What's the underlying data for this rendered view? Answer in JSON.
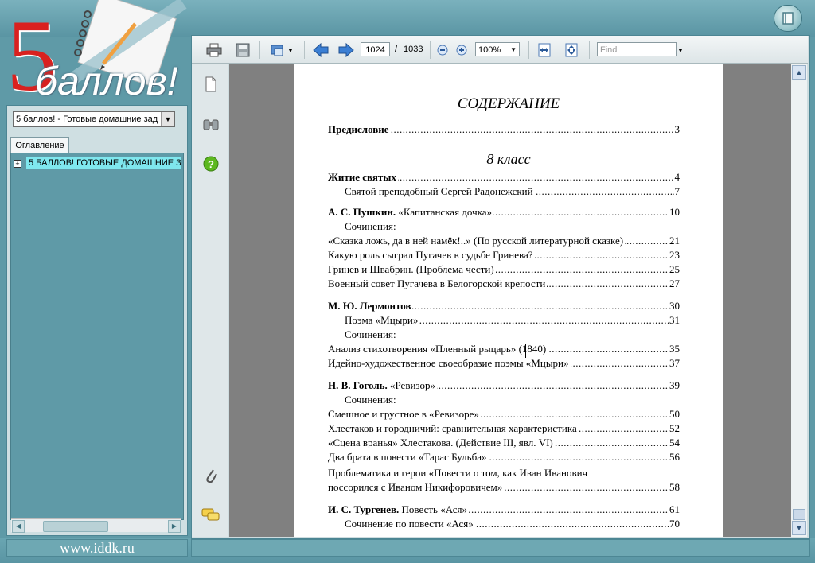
{
  "logo": {
    "number": "5",
    "word": "баллов!"
  },
  "left_panel": {
    "document_select": "5 баллов! - Готовые домашние зад",
    "tab_label": "Оглавление",
    "tree_item": "5 БАЛЛОВ! ГОТОВЫЕ ДОМАШНИЕ З",
    "tree_expand": "+"
  },
  "footer": {
    "site": "www.iddk.ru"
  },
  "toolbar": {
    "page_current": "1024",
    "page_separator": "/",
    "page_total": "1033",
    "zoom": "100%",
    "find_placeholder": "Find"
  },
  "document": {
    "title": "СОДЕРЖАНИЕ",
    "section": "8 класс",
    "rows": [
      {
        "text": "Предисловие",
        "bold_prefix": "Предисловие",
        "page": "3",
        "indent": false
      },
      {
        "text": "Житие святых",
        "bold_prefix": "Житие святых",
        "page": "4",
        "indent": false
      },
      {
        "text": "Святой преподобный Сергей Радонежский ",
        "bold_prefix": "",
        "page": " 7",
        "indent": true
      },
      {
        "text": " «Капитанская дочка» ",
        "bold_prefix": "А. С. Пушкин.",
        "page": "10",
        "indent": false
      },
      {
        "text": "Сочинения:",
        "bold_prefix": "",
        "page": "",
        "indent": true
      },
      {
        "text": "«Сказка ложь, да в ней намёк!..» (По русской литературной сказке)",
        "bold_prefix": "",
        "page": "21",
        "indent": false
      },
      {
        "text": "Какую роль сыграл Пугачев в судьбе Гринева?",
        "bold_prefix": "",
        "page": "23",
        "indent": false
      },
      {
        "text": "Гринев и Швабрин. (Проблема чести)",
        "bold_prefix": "",
        "page": "25",
        "indent": false
      },
      {
        "text": "Военный совет Пугачева в Белогорской крепости",
        "bold_prefix": "",
        "page": "27",
        "indent": false
      },
      {
        "text": " ",
        "bold_prefix": "М. Ю. Лермонтов",
        "page": "30",
        "indent": false
      },
      {
        "text": "Поэма «Мцыри» ",
        "bold_prefix": "",
        "page": "31",
        "indent": true
      },
      {
        "text": "Сочинения:",
        "bold_prefix": "",
        "page": "",
        "indent": true
      },
      {
        "text": "Анализ стихотворения «Пленный рыцарь» (1840)",
        "bold_prefix": "",
        "page": "35",
        "indent": false
      },
      {
        "text": "Идейно-художественное своеобразие поэмы «Мцыри»",
        "bold_prefix": "",
        "page": "37",
        "indent": false
      },
      {
        "text": " «Ревизор»",
        "bold_prefix": "Н. В. Гоголь.",
        "page": "39",
        "indent": false
      },
      {
        "text": "Сочинения:",
        "bold_prefix": "",
        "page": "",
        "indent": true
      },
      {
        "text": "Смешное и грустное в «Ревизоре»",
        "bold_prefix": "",
        "page": "50",
        "indent": false
      },
      {
        "text": "Хлестаков и городничий: сравнительная характеристика",
        "bold_prefix": "",
        "page": "52",
        "indent": false
      },
      {
        "text": "«Сцена вранья» Хлестакова. (Действие III, явл. VI)",
        "bold_prefix": "",
        "page": "54",
        "indent": false
      },
      {
        "text": "Два брата в повести «Тарас Бульба»",
        "bold_prefix": "",
        "page": "56",
        "indent": false
      },
      {
        "text": "Проблематика и герои «Повести о том, как Иван Иванович",
        "bold_prefix": "",
        "page": "",
        "indent": false
      },
      {
        "text": "поссорился с Иваном Никифоровичем»",
        "bold_prefix": "",
        "page": "58",
        "indent": false
      },
      {
        "text": " Повесть «Ася»",
        "bold_prefix": "И. С. Тургенев.",
        "page": "61",
        "indent": false
      },
      {
        "text": "Сочинение по повести «Ася»",
        "bold_prefix": "",
        "page": "70",
        "indent": true
      }
    ]
  },
  "colors": {
    "frame": "#5f9aa7",
    "logo_red": "#d9211f",
    "highlight": "#7fe7ee",
    "page_gray": "#808080"
  }
}
